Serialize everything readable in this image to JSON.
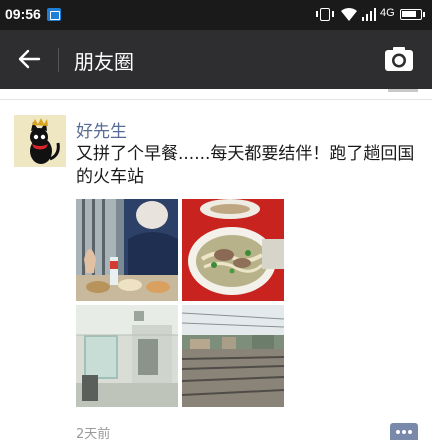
{
  "status_bar": {
    "time": "09:56",
    "network": "4G",
    "battery_level": 0.85
  },
  "app_bar": {
    "title": "朋友圈",
    "back_icon": "arrow-left-icon",
    "camera_icon": "camera-icon"
  },
  "post": {
    "author": "好先生",
    "text": "又拼了个早餐......每天都要结伴！跑了趟回国的火车站",
    "timestamp": "2天前",
    "photos": [
      {
        "id": "photo-1",
        "subject": "breakfast table with people"
      },
      {
        "id": "photo-2",
        "subject": "bowl of noodle soup"
      },
      {
        "id": "photo-3",
        "subject": "station room interior"
      },
      {
        "id": "photo-4",
        "subject": "railway tracks"
      }
    ]
  },
  "colors": {
    "status_bar_bg": "#1a1a1a",
    "app_bar_bg": "#2e2e30",
    "author_name": "#576b95",
    "timestamp": "#9a9a9a",
    "comment_button": "#7889a9"
  }
}
